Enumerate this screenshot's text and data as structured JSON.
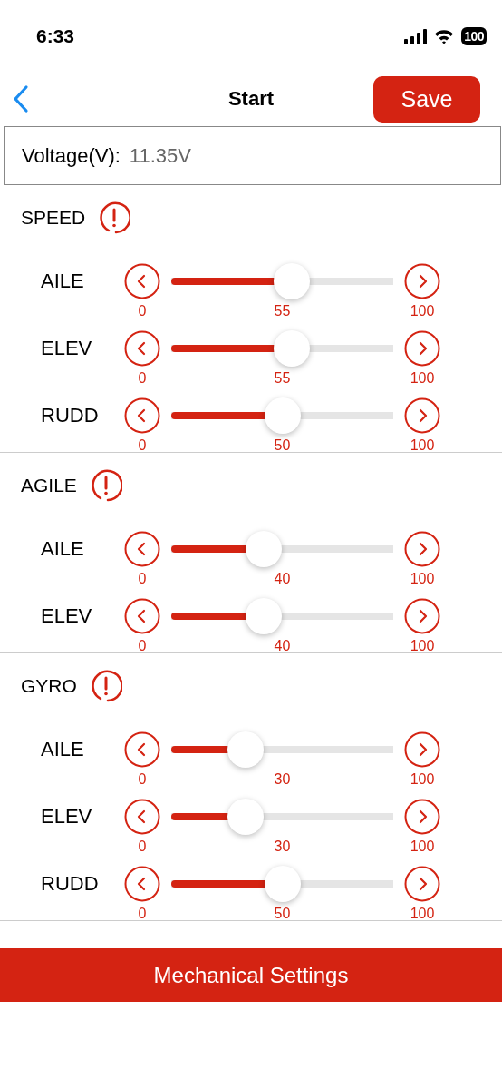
{
  "status_bar": {
    "time": "6:33",
    "battery": "100"
  },
  "nav": {
    "title": "Start",
    "save": "Save"
  },
  "voltage": {
    "label": "Voltage(V):",
    "value": "11.35V"
  },
  "sections": [
    {
      "title": "SPEED",
      "sliders": [
        {
          "name": "AILE",
          "min": "0",
          "value": "55",
          "max": "100",
          "level": 0.55
        },
        {
          "name": "ELEV",
          "min": "0",
          "value": "55",
          "max": "100",
          "level": 0.55
        },
        {
          "name": "RUDD",
          "min": "0",
          "value": "50",
          "max": "100",
          "level": 0.5
        }
      ]
    },
    {
      "title": "AGILE",
      "sliders": [
        {
          "name": "AILE",
          "min": "0",
          "value": "40",
          "max": "100",
          "level": 0.4
        },
        {
          "name": "ELEV",
          "min": "0",
          "value": "40",
          "max": "100",
          "level": 0.4
        }
      ]
    },
    {
      "title": "GYRO",
      "sliders": [
        {
          "name": "AILE",
          "min": "0",
          "value": "30",
          "max": "100",
          "level": 0.3
        },
        {
          "name": "ELEV",
          "min": "0",
          "value": "30",
          "max": "100",
          "level": 0.3
        },
        {
          "name": "RUDD",
          "min": "0",
          "value": "50",
          "max": "100",
          "level": 0.5
        }
      ]
    }
  ],
  "footer_button": "Mechanical Settings"
}
